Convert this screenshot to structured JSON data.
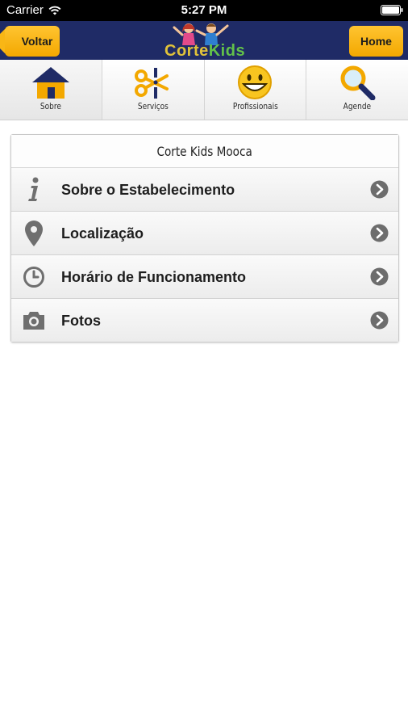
{
  "status_bar": {
    "carrier": "Carrier",
    "time": "5:27 PM"
  },
  "nav": {
    "back_label": "Voltar",
    "home_label": "Home",
    "logo_text_part1": "Corte",
    "logo_text_part2": "Kids"
  },
  "tabs": [
    {
      "label": "Sobre",
      "icon": "house-icon",
      "active": true
    },
    {
      "label": "Serviços",
      "icon": "scissors-icon",
      "active": false
    },
    {
      "label": "Profissionais",
      "icon": "smiley-icon",
      "active": false
    },
    {
      "label": "Agende",
      "icon": "magnifier-icon",
      "active": false
    }
  ],
  "card": {
    "title": "Corte Kids Mooca",
    "items": [
      {
        "label": "Sobre o Estabelecimento",
        "icon": "info-icon"
      },
      {
        "label": "Localização",
        "icon": "location-pin-icon"
      },
      {
        "label": "Horário de Funcionamento",
        "icon": "clock-icon"
      },
      {
        "label": "Fotos",
        "icon": "camera-icon"
      }
    ]
  },
  "colors": {
    "nav_background": "#1f2b66",
    "button_accent": "#f9b615",
    "icon_gray": "#6f6f6f"
  }
}
